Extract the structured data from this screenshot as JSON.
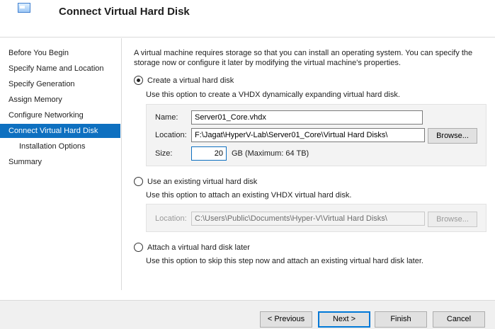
{
  "window": {
    "title": "Connect Virtual Hard Disk"
  },
  "sidebar": {
    "items": [
      {
        "label": "Before You Begin"
      },
      {
        "label": "Specify Name and Location"
      },
      {
        "label": "Specify Generation"
      },
      {
        "label": "Assign Memory"
      },
      {
        "label": "Configure Networking"
      },
      {
        "label": "Connect Virtual Hard Disk"
      },
      {
        "label": "Installation Options"
      },
      {
        "label": "Summary"
      }
    ],
    "active_index": 5
  },
  "main": {
    "intro": "A virtual machine requires storage so that you can install an operating system. You can specify the storage now or configure it later by modifying the virtual machine's properties.",
    "option_create": {
      "label": "Create a virtual hard disk",
      "description": "Use this option to create a VHDX dynamically expanding virtual hard disk.",
      "name_label": "Name:",
      "name_value": "Server01_Core.vhdx",
      "location_label": "Location:",
      "location_value": "F:\\Jagat\\HyperV-Lab\\Server01_Core\\Virtual Hard Disks\\",
      "browse_label": "Browse...",
      "size_label": "Size:",
      "size_value": "20",
      "size_unit": "GB (Maximum: 64 TB)"
    },
    "option_existing": {
      "label": "Use an existing virtual hard disk",
      "description": "Use this option to attach an existing VHDX virtual hard disk.",
      "location_label": "Location:",
      "location_value": "C:\\Users\\Public\\Documents\\Hyper-V\\Virtual Hard Disks\\",
      "browse_label": "Browse..."
    },
    "option_later": {
      "label": "Attach a virtual hard disk later",
      "description": "Use this option to skip this step now and attach an existing virtual hard disk later."
    }
  },
  "footer": {
    "previous": "< Previous",
    "next": "Next >",
    "finish": "Finish",
    "cancel": "Cancel"
  },
  "colors": {
    "accent": "#0e70c0",
    "default_button_border": "#0078d7"
  }
}
